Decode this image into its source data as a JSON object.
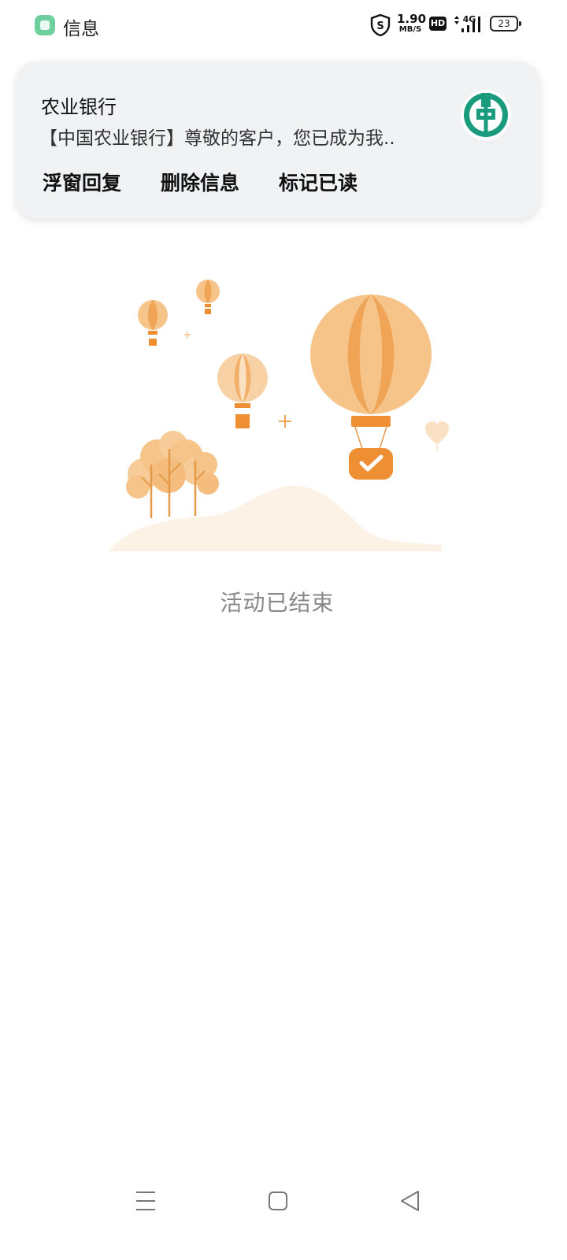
{
  "status_bar": {
    "app_name": "信息",
    "net_speed_value": "1.90",
    "net_speed_unit": "MB/S",
    "hd_label": "HD",
    "network_type": "4G",
    "battery_level": "23",
    "icons": [
      "shield-s-icon",
      "hd-icon",
      "signal-4g-icon",
      "battery-icon"
    ]
  },
  "notification": {
    "title": "农业银行",
    "body": "【中国农业银行】尊敬的客户，您已成为我..",
    "logo_icon": "abc-bank-logo",
    "actions": [
      {
        "label": "浮窗回复"
      },
      {
        "label": "删除信息"
      },
      {
        "label": "标记已读"
      }
    ]
  },
  "main": {
    "illustration": "hot-air-balloons-illustration",
    "message": "活动已结束"
  },
  "nav_bar": {
    "icons": [
      "menu-icon",
      "home-icon",
      "back-icon"
    ]
  },
  "colors": {
    "accent_orange": "#ee8f33",
    "balloon_light": "#f6c489",
    "bank_green": "#1b9b7e",
    "card_bg": "#f1f2f4",
    "muted_text": "#888888"
  }
}
